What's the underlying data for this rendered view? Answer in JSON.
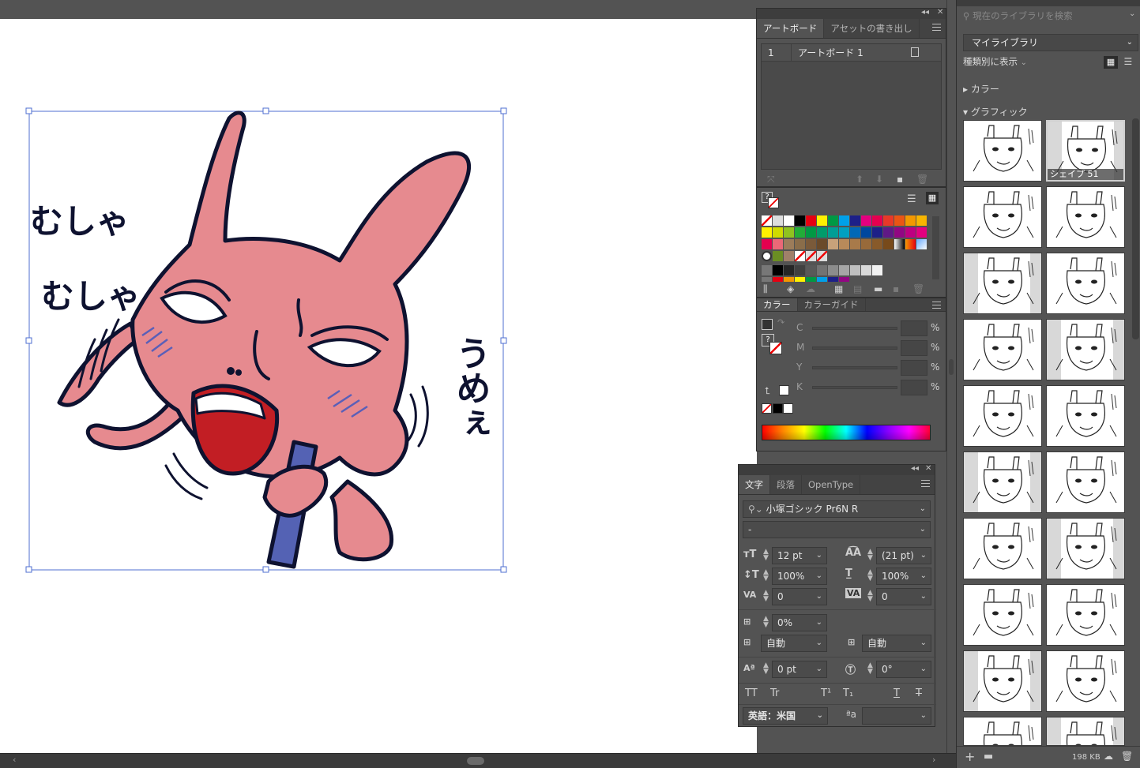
{
  "artboards_panel": {
    "tabs": [
      "アートボード",
      "アセットの書き出し"
    ],
    "rows": [
      {
        "num": "1",
        "name": "アートボード 1"
      }
    ]
  },
  "swatches_panel": {
    "unknown_label": "?"
  },
  "color_panel": {
    "tabs": [
      "カラー",
      "カラーガイド"
    ],
    "unknown_label": "?",
    "channels": [
      "C",
      "M",
      "Y",
      "K"
    ],
    "percent": "%"
  },
  "character_panel": {
    "tabs": [
      "文字",
      "段落",
      "OpenType"
    ],
    "font_family": "小塚ゴシック Pr6N R",
    "font_style": "-",
    "font_size": "12 pt",
    "leading": "(21 pt)",
    "vertical_scale": "100%",
    "horizontal_scale": "100%",
    "kerning": "0",
    "tracking": "0",
    "tsume": "0%",
    "aki_before": "自動",
    "aki_after": "自動",
    "baseline_shift": "0 pt",
    "rotation": "0°",
    "style_buttons": [
      "TT",
      "Tr",
      "T¹",
      "T₁",
      "T",
      "T"
    ],
    "language": "英語：米国",
    "aa_label": "ªa"
  },
  "libraries": {
    "search_placeholder": "現在のライブラリを検索",
    "library_name": "マイライブラリ",
    "view_mode": "種類別に表示",
    "sections": {
      "color": "カラー",
      "graphics": "グラフィック"
    },
    "selected_thumb_label": "シェイプ 51",
    "file_size": "198 KB"
  },
  "artwork": {
    "text_left_1": "むしゃ",
    "text_left_2": "むしゃ",
    "text_right": "うめぇ"
  },
  "colors": {
    "bunny_pink": "#e68a8f",
    "mouth_red": "#c21e24",
    "stick_blue": "#5462b4",
    "outline": "#0e1230",
    "selection": "#4f6fd0"
  }
}
